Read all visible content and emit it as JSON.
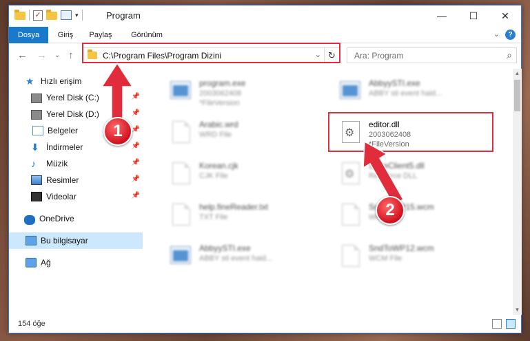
{
  "window": {
    "title": "Program",
    "controls": {
      "minimize": "—",
      "maximize": "☐",
      "close": "✕"
    }
  },
  "ribbon": {
    "tabs": [
      {
        "label": "Dosya"
      },
      {
        "label": "Giriş"
      },
      {
        "label": "Paylaş"
      },
      {
        "label": "Görünüm"
      }
    ],
    "expand": "⌄",
    "help": "?"
  },
  "navbar": {
    "back": "←",
    "forward": "→",
    "recent": "⌄",
    "up": "↑",
    "address": "C:\\Program Files\\Program Dizini",
    "address_drop": "⌄",
    "refresh": "↻",
    "search_placeholder": "Ara: Program",
    "search_icon": "search-icon"
  },
  "sidebar": {
    "items": [
      {
        "label": "Hızlı erişim",
        "icon": "star-icon"
      },
      {
        "label": "Yerel Disk (C:)",
        "icon": "disk-icon",
        "pinned": true
      },
      {
        "label": "Yerel Disk (D:)",
        "icon": "disk-icon",
        "pinned": true
      },
      {
        "label": "Belgeler",
        "icon": "document-icon",
        "pinned": true
      },
      {
        "label": "İndirmeler",
        "icon": "download-icon",
        "pinned": true
      },
      {
        "label": "Müzik",
        "icon": "music-icon",
        "pinned": true
      },
      {
        "label": "Resimler",
        "icon": "pictures-icon",
        "pinned": true
      },
      {
        "label": "Videolar",
        "icon": "video-icon",
        "pinned": true
      },
      {
        "label": "OneDrive",
        "icon": "cloud-icon"
      },
      {
        "label": "Bu bilgisayar",
        "icon": "computer-icon",
        "selected": true
      },
      {
        "label": "Ağ",
        "icon": "network-icon"
      }
    ],
    "pin_glyph": "📌"
  },
  "files": [
    {
      "name": "program.exe",
      "sub1": "2003062408",
      "sub2": "*FileVersion",
      "type": "exe",
      "blurred": true
    },
    {
      "name": "AbbyySTI.exe",
      "sub1": "ABBY sti event haid...",
      "type": "exe",
      "blurred": true
    },
    {
      "name": "Arabic.wrd",
      "sub1": "WRD File",
      "type": "page",
      "blurred": true
    },
    {
      "name": "editor.dll",
      "sub1": "2003062408",
      "sub2": "*FileVersion",
      "type": "dll",
      "blurred": false
    },
    {
      "name": "Korean.cjk",
      "sub1": "CJK File",
      "type": "page",
      "blurred": true
    },
    {
      "name": "StateClient5.dll",
      "sub1": "Resource DLL",
      "type": "dll",
      "blurred": true
    },
    {
      "name": "help.fineReader.txt",
      "sub1": "TXT File",
      "type": "page",
      "blurred": true
    },
    {
      "name": "SndToWP15.wcm",
      "sub1": "WCM File",
      "type": "page",
      "blurred": true
    },
    {
      "name": "AbbyySTI.exe",
      "sub1": "ABBY sti event haid...",
      "type": "exe",
      "blurred": true
    },
    {
      "name": "SndToWP12.wcm",
      "sub1": "WCM File",
      "type": "page",
      "blurred": true
    }
  ],
  "status": {
    "count": "154 öğe"
  },
  "annotations": {
    "badge1": "1",
    "badge2": "2",
    "color": "#e12d3b"
  }
}
